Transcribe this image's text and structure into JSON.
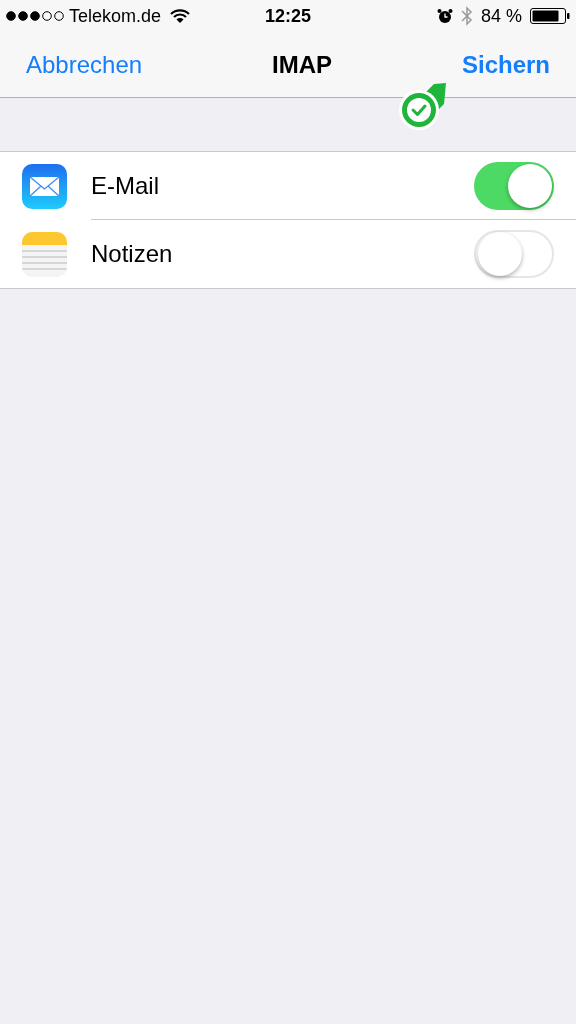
{
  "status_bar": {
    "carrier": "Telekom.de",
    "time": "12:25",
    "battery": "84 %"
  },
  "nav": {
    "cancel": "Abbrechen",
    "title": "IMAP",
    "save": "Sichern"
  },
  "items": [
    {
      "kind": "mail",
      "label": "E-Mail",
      "on": true
    },
    {
      "kind": "notes",
      "label": "Notizen",
      "on": false
    }
  ]
}
